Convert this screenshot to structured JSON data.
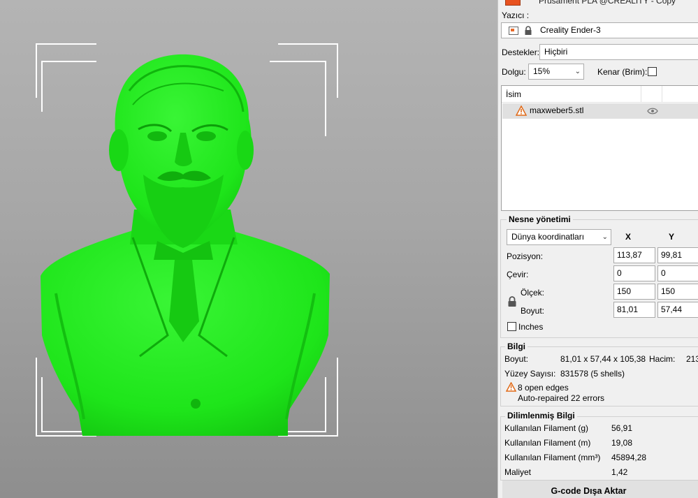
{
  "viewport": {
    "model_color": "#1ee51a",
    "model_shade": "#0fb10d",
    "bracket_color": "#ffffff"
  },
  "panel": {
    "filament_label": "Prusament PLA @CREALITY - Copy",
    "filament_color": "#e8521f",
    "printer_label": "Yazıcı :",
    "printer_value": "Creality Ender-3",
    "supports_label": "Destekler:",
    "supports_value": "Hiçbiri",
    "infill_label": "Dolgu:",
    "infill_value": "15%",
    "brim_label": "Kenar (Brim):",
    "brim_checked": false
  },
  "object_list": {
    "header_name": "İsim",
    "items": [
      {
        "name": "maxweber5.stl",
        "warning_icon": "warning-icon",
        "visibility_icon": "eye-icon"
      }
    ]
  },
  "object_manipulation": {
    "title": "Nesne yönetimi",
    "coord_system": "Dünya koordinatları",
    "col_x": "X",
    "col_y": "Y",
    "position_label": "Pozisyon:",
    "position_x": "113,87",
    "position_y": "99,81",
    "rotate_label": "Çevir:",
    "rotate_x": "0",
    "rotate_y": "0",
    "scale_label": "Ölçek:",
    "scale_x": "150",
    "scale_y": "150",
    "size_label": "Boyut:",
    "size_x": "81,01",
    "size_y": "57,44",
    "inches_label": "Inches",
    "lock_icon": "lock-icon"
  },
  "info": {
    "title": "Bilgi",
    "size_label": "Boyut:",
    "size_value": "81,01 x 57,44 x 105,38",
    "volume_label": "Hacim:",
    "volume_value": "213",
    "facets_label": "Yüzey Sayısı:",
    "facets_value": "831578 (5 shells)",
    "warning_line1": "8 open edges",
    "warning_line2": "Auto-repaired 22 errors",
    "warning_color": "#e06a18"
  },
  "sliced_info": {
    "title": "Dilimlenmiş Bilgi",
    "rows": [
      {
        "label": "Kullanılan Filament (g)",
        "value": "56,91"
      },
      {
        "label": "Kullanılan Filament (m)",
        "value": "19,08"
      },
      {
        "label": "Kullanılan Filament (mm³)",
        "value": "45894,28"
      },
      {
        "label": "Maliyet",
        "value": "1,42"
      }
    ]
  },
  "export_button": "G-code Dışa Aktar"
}
